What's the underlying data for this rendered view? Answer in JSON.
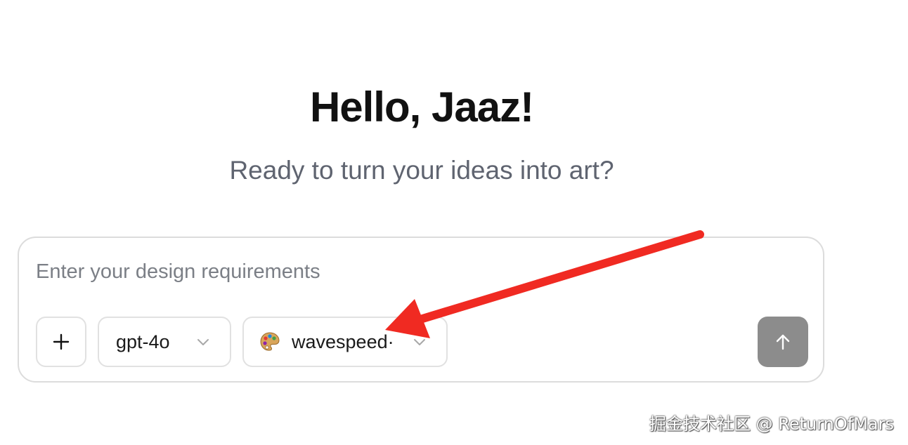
{
  "greeting": {
    "title": "Hello, Jaaz!",
    "subtitle": "Ready to turn your ideas into art?"
  },
  "composer": {
    "placeholder": "Enter your design requirements",
    "add_label": "+",
    "model": {
      "selected": "gpt-4o",
      "icon": "chevron-down-icon"
    },
    "tool": {
      "selected": "wavespeed·",
      "icon": "palette-icon"
    },
    "send": {
      "icon": "arrow-up-icon",
      "color": "#8c8c8c"
    }
  },
  "annotation": {
    "arrow_color": "#f02a22"
  },
  "watermark": "掘金技术社区 @ ReturnOfMars"
}
